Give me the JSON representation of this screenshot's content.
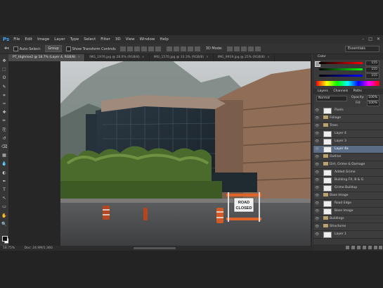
{
  "app": {
    "logo": "Ps"
  },
  "menu": [
    "File",
    "Edit",
    "Image",
    "Layer",
    "Type",
    "Select",
    "Filter",
    "3D",
    "View",
    "Window",
    "Help"
  ],
  "window_controls": [
    "–",
    "□",
    "✕"
  ],
  "options": {
    "auto_select": "Auto-Select:",
    "auto_select_target": "Group",
    "show_transform": "Show Transform Controls",
    "mode_3d": "3D Mode:",
    "workspace": "Essentials"
  },
  "tabs": [
    {
      "label": "PT_Highrise2 @ 18.7% (Layer 4, RGB/8)",
      "active": true
    },
    {
      "label": "IMG_1976.jpg @ 28.6% (RGB/8)",
      "active": false
    },
    {
      "label": "IMG_1570.jpg @ 33.3% (RGB/8)",
      "active": false
    },
    {
      "label": "IMG_9919.jpg @ 25% (RGB/8)",
      "active": false
    }
  ],
  "tools": [
    "move",
    "marquee",
    "lasso",
    "quick-select",
    "crop",
    "eyedropper",
    "healing",
    "brush",
    "stamp",
    "history-brush",
    "eraser",
    "gradient",
    "blur",
    "dodge",
    "pen",
    "type",
    "path-select",
    "shape",
    "hand",
    "zoom"
  ],
  "status": {
    "zoom": "18.75%",
    "doc": "Doc: 24.9M/1.36G"
  },
  "sign": {
    "line1": "ROAD",
    "line2": "CLOSED"
  },
  "color_panel": {
    "title": "Color",
    "r": "155",
    "g": "155",
    "b": "155"
  },
  "layers_panel": {
    "tabs": [
      "Layers",
      "Channels",
      "Paths"
    ],
    "blend": "Normal",
    "opacity_label": "Opacity:",
    "opacity": "100%",
    "fill_label": "Fill:",
    "fill": "100%",
    "rows": [
      {
        "name": "Pixels",
        "type": "layer",
        "selected": false
      },
      {
        "name": "Foliage",
        "type": "group",
        "selected": false
      },
      {
        "name": "Trees",
        "type": "group",
        "selected": false
      },
      {
        "name": "Layer 4",
        "type": "layer",
        "selected": false
      },
      {
        "name": "Layer 3",
        "type": "layer",
        "selected": false
      },
      {
        "name": "Layer 4a",
        "type": "layer",
        "selected": true
      },
      {
        "name": "Outline",
        "type": "group",
        "selected": false
      },
      {
        "name": "Dirt, Grime & Damage",
        "type": "group",
        "selected": false
      },
      {
        "name": "Added Grime",
        "type": "layer",
        "selected": false
      },
      {
        "name": "Building FX, B & G",
        "type": "layer",
        "selected": false
      },
      {
        "name": "Grime Buildup",
        "type": "layer",
        "selected": false
      },
      {
        "name": "Base Image",
        "type": "group",
        "selected": false
      },
      {
        "name": "Road Edge",
        "type": "layer",
        "selected": false
      },
      {
        "name": "Base Image",
        "type": "layer",
        "selected": false
      },
      {
        "name": "Buildings",
        "type": "group",
        "selected": false
      },
      {
        "name": "Structures",
        "type": "group",
        "selected": false
      },
      {
        "name": "Layer 1",
        "type": "layer",
        "selected": false
      }
    ]
  },
  "colors": {
    "accent": "#3fa4f3",
    "selected_layer": "#5a6c86"
  }
}
